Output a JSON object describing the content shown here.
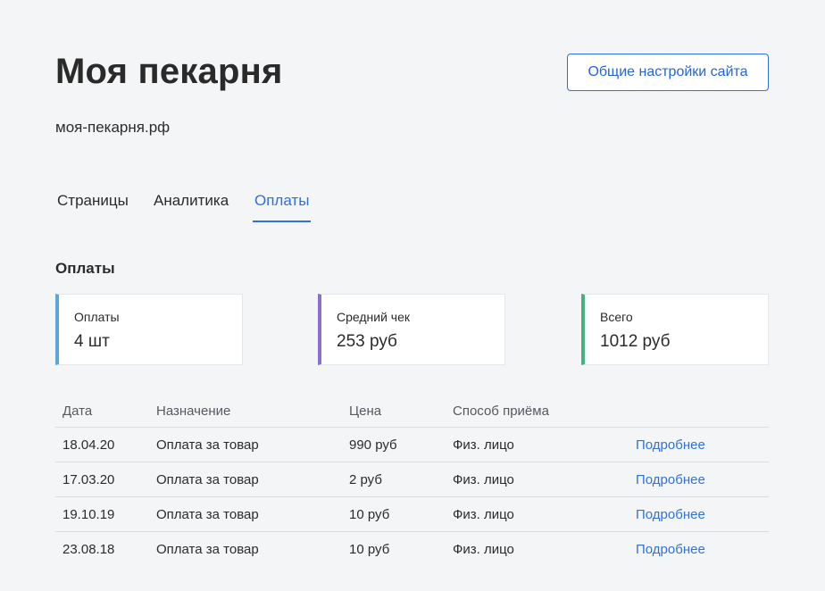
{
  "header": {
    "title": "Моя пекарня",
    "domain": "моя-пекарня.рф",
    "settings_button": "Общие настройки сайта"
  },
  "tabs": [
    {
      "label": "Страницы",
      "active": false
    },
    {
      "label": "Аналитика",
      "active": false
    },
    {
      "label": "Оплаты",
      "active": true
    }
  ],
  "section_title": "Оплаты",
  "stats": [
    {
      "label": "Оплаты",
      "value": "4 шт",
      "accent": "#5aa7e0"
    },
    {
      "label": "Средний чек",
      "value": "253 руб",
      "accent": "#8b6fd6"
    },
    {
      "label": "Всего",
      "value": "1012 руб",
      "accent": "#46b27f"
    }
  ],
  "table": {
    "columns": [
      "Дата",
      "Назначение",
      "Цена",
      "Способ приёма"
    ],
    "rows": [
      {
        "date": "18.04.20",
        "purpose": "Оплата за товар",
        "price": "990 руб",
        "method": "Физ. лицо",
        "link": "Подробнее"
      },
      {
        "date": "17.03.20",
        "purpose": "Оплата за товар",
        "price": "2 руб",
        "method": "Физ. лицо",
        "link": "Подробнее"
      },
      {
        "date": "19.10.19",
        "purpose": "Оплата за товар",
        "price": "10 руб",
        "method": "Физ. лицо",
        "link": "Подробнее"
      },
      {
        "date": "23.08.18",
        "purpose": "Оплата за товар",
        "price": "10 руб",
        "method": "Физ. лицо",
        "link": "Подробнее"
      }
    ]
  },
  "colors": {
    "accent_blue": "#2f6fe0",
    "link_blue": "#2f73d8",
    "background": "#f4f5f7"
  }
}
